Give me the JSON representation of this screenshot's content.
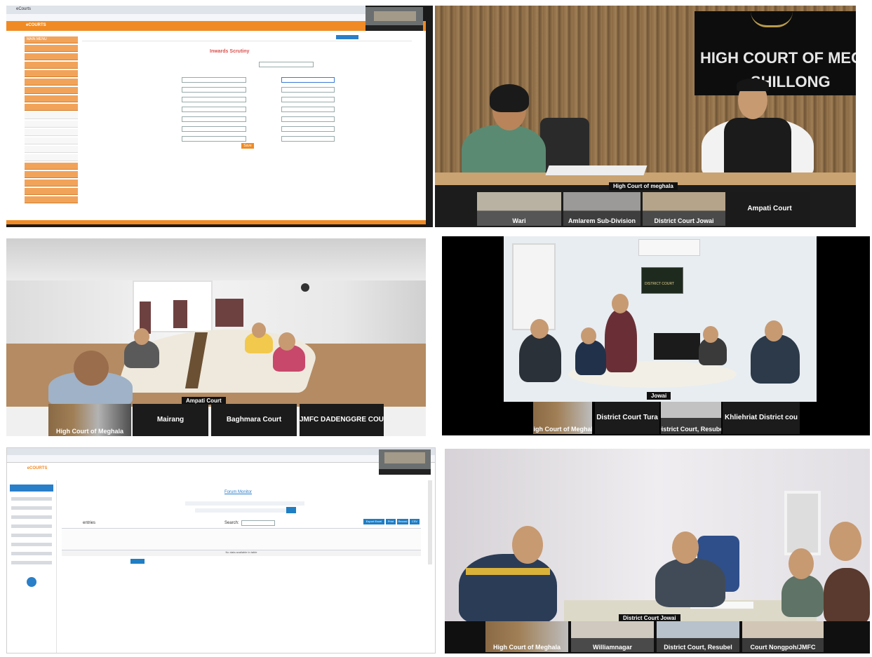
{
  "tile1": {
    "tab_title": "eCourts",
    "app_brand": "eCOURTS",
    "menu_header": "MAIN MENU",
    "form_title": "Inwards Scrutiny",
    "submit_label": "Save"
  },
  "tile2": {
    "sign_line1": "HIGH COURT OF MEGH",
    "sign_line2": "SHILLONG",
    "main_caption": "High Court of meghala",
    "thumbs": [
      "Wari",
      "Amlarem Sub-Division",
      "District Court Jowai",
      "Ampati Court"
    ]
  },
  "tile3": {
    "main_caption": "Ampati Court",
    "thumbs": [
      "High Court of Meghala",
      "Mairang",
      "Baghmara Court",
      "JMFC DADENGGRE COU"
    ]
  },
  "tile4": {
    "sign_text": "DISTRICT COURT",
    "main_caption": "Jowai",
    "thumbs": [
      "High Court of Meghala",
      "District Court Tura",
      "District Court, Resubel",
      "Khliehriat District cou"
    ]
  },
  "tile5": {
    "brand": "eCOURTS",
    "page_title": "Forum Monitor",
    "show_entries_label": "entries",
    "search_label": "Search:",
    "empty_table_text": "No data available in table",
    "action_buttons": [
      "Export Excel",
      "Print",
      "Record",
      "CSV"
    ]
  },
  "tile6": {
    "main_caption": "District Court Jowai",
    "thumbs": [
      "High Court of Meghala",
      "Williamnagar",
      "District Court, Resubel",
      "Court Nongpoh/JMFC"
    ]
  },
  "colors": {
    "orange": "#f08a24",
    "blue_btn": "#1f7ec4",
    "wood": "#8a6a45"
  }
}
